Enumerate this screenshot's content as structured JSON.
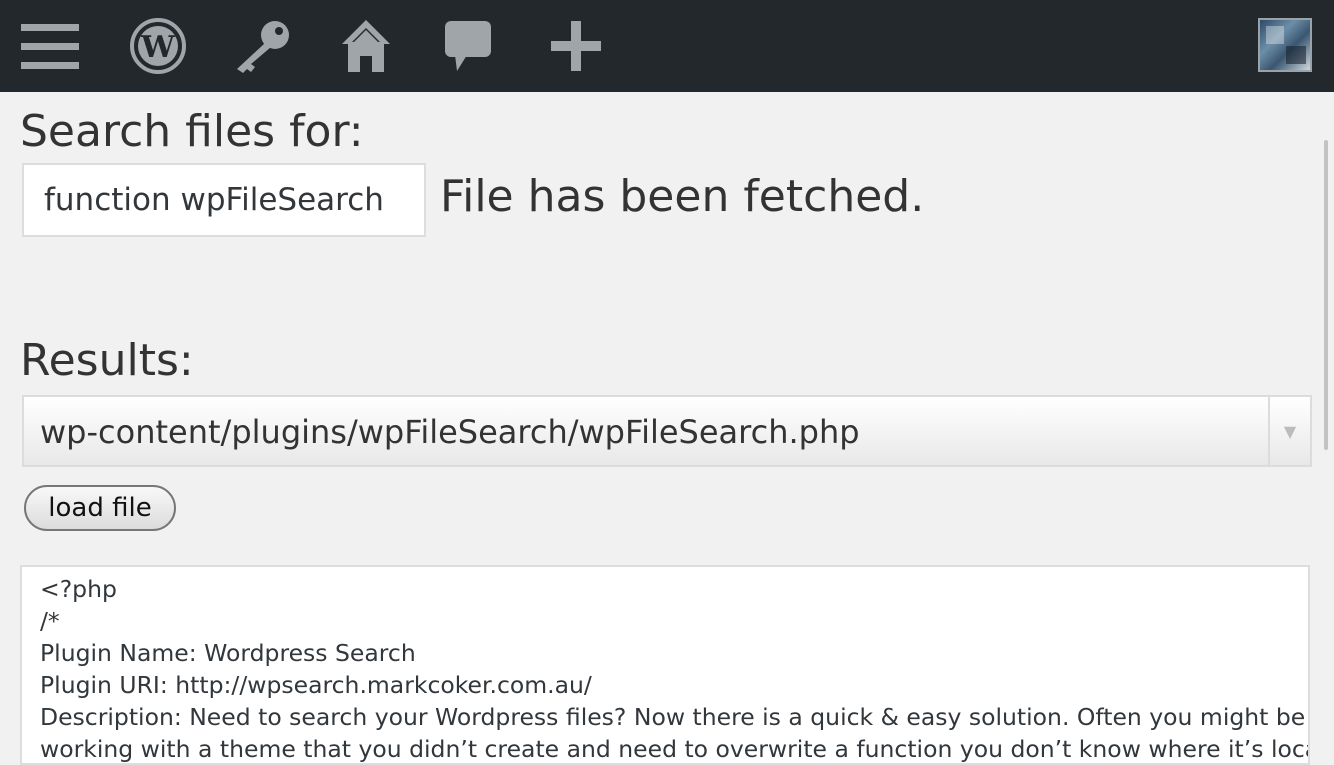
{
  "admin_bar": {
    "icons": [
      "menu-icon",
      "wordpress-icon",
      "key-icon",
      "home-icon",
      "comment-icon",
      "plus-icon"
    ]
  },
  "search": {
    "label": "Search files for:",
    "input_value": "function wpFileSearch",
    "status": "File has been fetched."
  },
  "results": {
    "label": "Results:",
    "selected": "wp-content/plugins/wpFileSearch/wpFileSearch.php"
  },
  "load_button": "load file",
  "editor": {
    "lines": [
      "<?php",
      "    /*",
      "    Plugin Name: Wordpress Search",
      "    Plugin URI: http://wpsearch.markcoker.com.au/",
      "    Description: Need to search your Wordpress files? Now there is a quick & easy solution. Often you might be",
      "working with a theme that you didn’t create and need to overwrite a function you don’t know where it’s located"
    ]
  },
  "colors": {
    "admin_bar_bg": "#23282d",
    "page_bg": "#f1f1f1",
    "icon_color": "#a0a5aa"
  }
}
